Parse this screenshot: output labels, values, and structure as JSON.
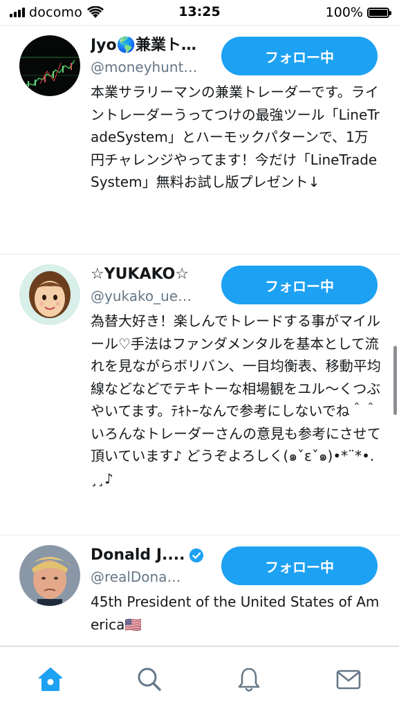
{
  "status_bar": {
    "carrier": "docomo",
    "time": "13:25",
    "battery": "100%",
    "battery_level": 1.0
  },
  "users": [
    {
      "name": "Jyo🌎兼業ト…",
      "handle": "@moneyhunt…",
      "follow_label": "フォロー中",
      "bio": "本業サラリーマンの兼業トレーダーです。ライントレーダーうってつけの最強ツール「LineTradeSystem」とハーモックパターンで、1万円チャレンジやってます！今だけ「LineTradeSystem」無料お試し版プレゼント↓",
      "verified": false
    },
    {
      "name": "☆YUKAKO☆",
      "handle": "@yukako_ue…",
      "follow_label": "フォロー中",
      "bio": "為替大好き！楽しんでトレードする事がマイルール♡手法はファンダメンタルを基本として流れを見ながらボリバン、一目均衡表、移動平均線などなどでテキトーな相場観をユル〜くつぶやいてます。ﾃｷﾄｰなんで参考にしないでね＾＾ いろんなトレーダーさんの意見も参考にさせて頂いています♪ どうぞよろしく(๑ˇεˇ๑)•*¨*•.¸¸♪",
      "verified": false
    },
    {
      "name": "Donald J....",
      "handle": "@realDona…",
      "follow_label": "フォロー中",
      "bio": "45th President of the United States of America🇺🇸",
      "verified": true
    }
  ],
  "tab_bar": {
    "items": [
      {
        "icon": "home-icon",
        "active": true
      },
      {
        "icon": "search-icon",
        "active": false
      },
      {
        "icon": "bell-icon",
        "active": false
      },
      {
        "icon": "mail-icon",
        "active": false
      }
    ]
  },
  "colors": {
    "accent": "#1da1f2",
    "text_primary": "#14171a",
    "text_secondary": "#657786",
    "tab_inactive": "#657786"
  }
}
